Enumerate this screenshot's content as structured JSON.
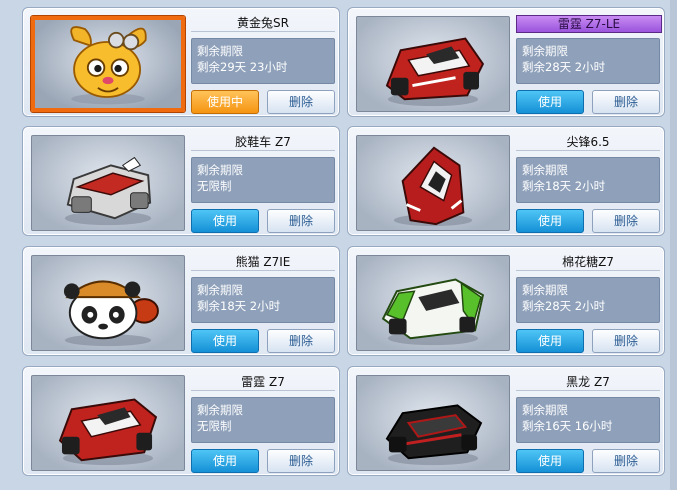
{
  "labels": {
    "remaining": "剩余期限"
  },
  "colors": {
    "use_button": "#1590d6",
    "using_button": "#f59411",
    "highlight_name": "#9a54dc"
  },
  "items": [
    {
      "name": "黄金兔SR",
      "time": "剩余29天 23小时",
      "action": "使用中",
      "delete": "删除",
      "state": "in-use",
      "icon": "golden-rabbit-icon"
    },
    {
      "name": "雷霆 Z7-LE",
      "time": "剩余28天 2小时",
      "action": "使用",
      "delete": "删除",
      "state": "available",
      "icon": "red-kart-icon"
    },
    {
      "name": "胶鞋车 Z7",
      "time": "无限制",
      "action": "使用",
      "delete": "删除",
      "state": "available",
      "icon": "sneaker-kart-icon"
    },
    {
      "name": "尖锋6.5",
      "time": "剩余18天 2小时",
      "action": "使用",
      "delete": "删除",
      "state": "available",
      "icon": "red-racer-icon"
    },
    {
      "name": "熊猫 Z7IE",
      "time": "剩余18天 2小时",
      "action": "使用",
      "delete": "删除",
      "state": "available",
      "icon": "panda-icon"
    },
    {
      "name": "棉花糖Z7",
      "time": "剩余28天 2小时",
      "action": "使用",
      "delete": "删除",
      "state": "available",
      "icon": "green-kart-icon"
    },
    {
      "name": "雷霆 Z7",
      "time": "无限制",
      "action": "使用",
      "delete": "删除",
      "state": "available",
      "icon": "red-kart-icon"
    },
    {
      "name": "黑龙 Z7",
      "time": "剩余16天 16小时",
      "action": "使用",
      "delete": "删除",
      "state": "available",
      "icon": "black-kart-icon"
    }
  ]
}
